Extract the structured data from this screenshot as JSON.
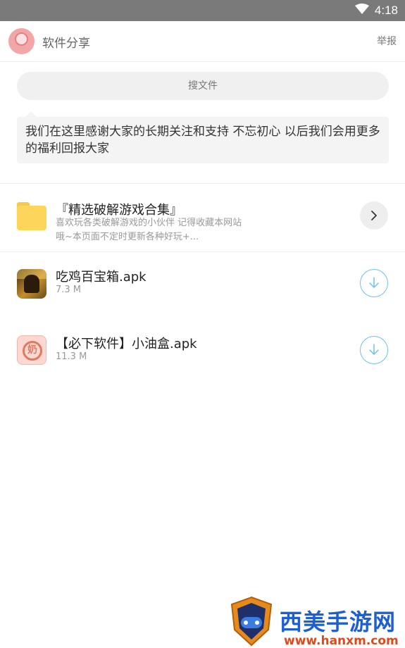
{
  "status_bar": {
    "time": "4:18",
    "icons": [
      "wifi-icon"
    ]
  },
  "header": {
    "app_name": "软件分享",
    "report_label": "举报",
    "avatar_icon": "avatar-logo-icon"
  },
  "search": {
    "placeholder": "搜文件"
  },
  "notice": {
    "text": "我们在这里感谢大家的长期关注和支持 不忘初心 以后我们会用更多的福利回报大家"
  },
  "folder": {
    "title": "『精选破解游戏合集』",
    "description_line1": "喜欢玩各类破解游戏的小伙伴 记得收藏本网站",
    "description_line2": "哦~本页面不定时更新各种好玩+...",
    "icon": "folder-icon",
    "action_icon": "chevron-right-icon"
  },
  "files": [
    {
      "name": "吃鸡百宝箱.apk",
      "size": "7.3 M",
      "icon": "game-app-icon",
      "action_icon": "download-icon"
    },
    {
      "name": "【必下软件】小油盒.apk",
      "size": "11.3 M",
      "icon": "oil-box-app-icon",
      "action_icon": "download-icon"
    }
  ],
  "watermark": {
    "title": "西美手游网",
    "url": "www.hanxm.com"
  },
  "colors": {
    "status_bar": "#7a7a7a",
    "folder": "#fcd55a",
    "download_accent": "#6ec3e6",
    "watermark_blue": "#1d5fd1",
    "watermark_orange": "#e0481a"
  }
}
